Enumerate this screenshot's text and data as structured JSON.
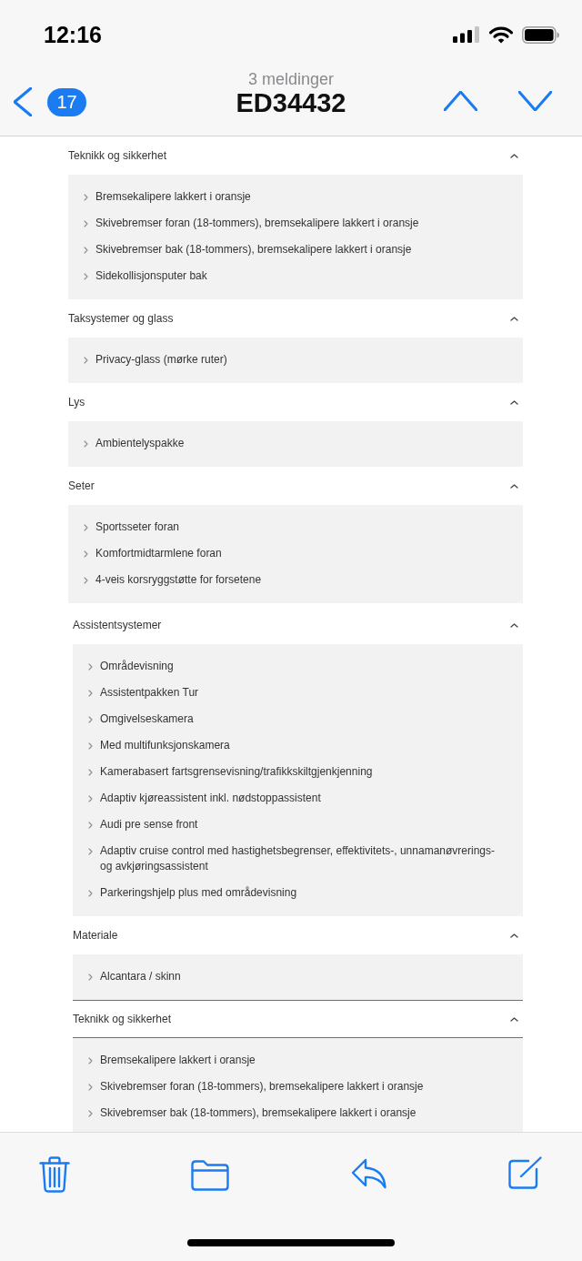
{
  "status_bar": {
    "time": "12:16"
  },
  "navigation": {
    "unread_count": "17",
    "subtitle": "3 meldinger",
    "title": "ED34432"
  },
  "equipment_lists": [
    {
      "sections": [
        {
          "title": "Teknikk og sikkerhet",
          "expanded": true,
          "bordered": false,
          "items": [
            "Bremsekalipere lakkert i oransje",
            "Skivebremser foran (18-tommers), bremsekalipere lakkert i oransje",
            "Skivebremser bak (18-tommers), bremsekalipere lakkert i oransje",
            "Sidekollisjonsputer bak"
          ]
        },
        {
          "title": "Taksystemer og glass",
          "expanded": true,
          "bordered": false,
          "items": [
            "Privacy-glass (mørke ruter)"
          ]
        },
        {
          "title": "Lys",
          "expanded": true,
          "bordered": false,
          "items": [
            "Ambientelyspakke"
          ]
        },
        {
          "title": "Seter",
          "expanded": true,
          "bordered": false,
          "items": [
            "Sportsseter foran",
            "Komfortmidtarmlene foran",
            "4-veis korsryggstøtte for forsetene"
          ]
        }
      ]
    },
    {
      "sections": [
        {
          "title": "Assistentsystemer",
          "expanded": true,
          "bordered": false,
          "items": [
            "Områdevisning",
            "Assistentpakken Tur",
            "Omgivelseskamera",
            "Med multifunksjonskamera",
            "Kamerabasert fartsgrensevisning/trafikkskiltgjenkjenning",
            "Adaptiv kjøreassistent inkl. nødstoppassistent",
            "Audi pre sense front",
            "Adaptiv cruise control med hastighetsbegrenser, effektivitets-, unnamanøvrerings- og avkjøringsassistent",
            "Parkeringshjelp plus med områdevisning"
          ]
        },
        {
          "title": "Materiale",
          "expanded": true,
          "bordered": false,
          "items": [
            "Alcantara / skinn"
          ]
        },
        {
          "title": "Teknikk og sikkerhet",
          "expanded": true,
          "bordered": true,
          "items": [
            "Bremsekalipere lakkert i oransje",
            "Skivebremser foran (18-tommers), bremsekalipere lakkert i oransje",
            "Skivebremser bak (18-tommers), bremsekalipere lakkert i oransje"
          ]
        }
      ]
    }
  ]
}
